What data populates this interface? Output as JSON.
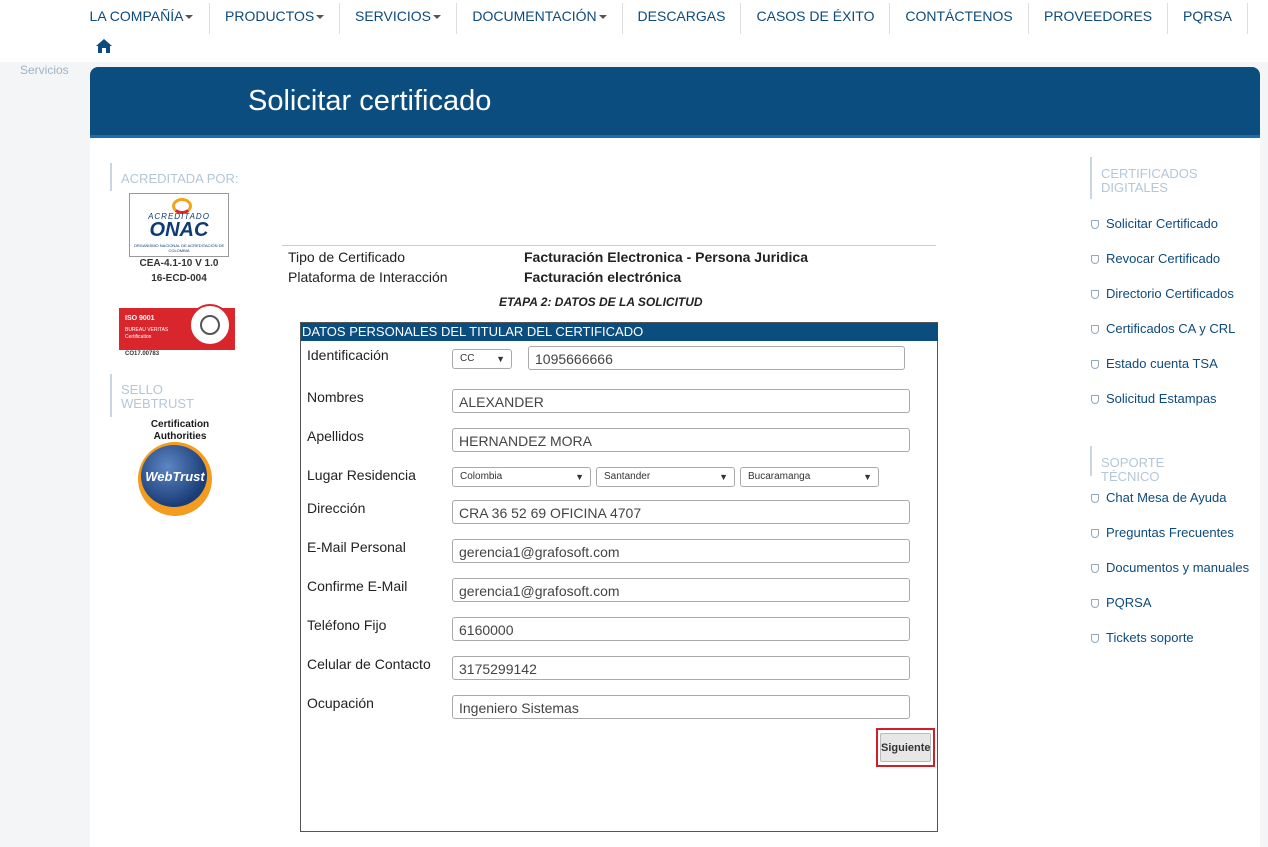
{
  "nav": {
    "items": [
      {
        "label": "LA COMPAÑÍA",
        "dropdown": true
      },
      {
        "label": "PRODUCTOS",
        "dropdown": true
      },
      {
        "label": "SERVICIOS",
        "dropdown": true
      },
      {
        "label": "DOCUMENTACIÓN",
        "dropdown": true
      },
      {
        "label": "DESCARGAS",
        "dropdown": false
      },
      {
        "label": "CASOS DE ÉXITO",
        "dropdown": false
      },
      {
        "label": "CONTÁCTENOS",
        "dropdown": false
      },
      {
        "label": "PROVEEDORES",
        "dropdown": false
      },
      {
        "label": "PQRSA",
        "dropdown": false
      }
    ],
    "home_icon": "home-icon"
  },
  "breadcrumb": "Servicios",
  "page_title": "Solicitar certificado",
  "left": {
    "accredited_title": "ACREDITADA POR:",
    "onac": {
      "acc": "ACREDITADO",
      "name": "ONAC",
      "small": "ORGANISMO NACIONAL DE ACREDITACIÓN DE COLOMBIA",
      "code1": "CEA-4.1-10 V 1.0",
      "code2": "16-ECD-004"
    },
    "bv": {
      "iso": "ISO 9001",
      "line1": "BUREAU VERITAS",
      "line2": "Certification",
      "code": "CO17.00783"
    },
    "webtrust_title": "SELLO WEBTRUST",
    "webtrust_caption": "Certification Authorities",
    "webtrust_name": "WebTrust"
  },
  "right": {
    "certs_title": "CERTIFICADOS DIGITALES",
    "certs_links": [
      "Solicitar Certificado",
      "Revocar Certificado",
      "Directorio Certificados",
      "Certificados CA y CRL",
      "Estado cuenta TSA",
      "Solicitud Estampas"
    ],
    "support_title": "SOPORTE TÉCNICO",
    "support_links": [
      "Chat Mesa de Ayuda",
      "Preguntas Frecuentes",
      "Documentos y manuales",
      "PQRSA",
      "Tickets soporte"
    ]
  },
  "info": {
    "tipo_label": "Tipo de Certificado",
    "tipo_value": "Facturación Electronica - Persona Juridica",
    "plataforma_label": "Plataforma de Interacción",
    "plataforma_value": "Facturación electrónica"
  },
  "etapa": "ETAPA 2: DATOS DE LA SOLICITUD",
  "form": {
    "header": "DATOS PERSONALES DEL TITULAR DEL CERTIFICADO",
    "id_label": "Identificación",
    "id_type": "CC",
    "id_number": "1095666666",
    "nombres_label": "Nombres",
    "nombres": "ALEXANDER",
    "apellidos_label": "Apellidos",
    "apellidos": "HERNANDEZ MORA",
    "lugar_label": "Lugar Residencia",
    "pais": "Colombia",
    "departamento": "Santander",
    "ciudad": "Bucaramanga",
    "direccion_label": "Dirección",
    "direccion": "CRA 36 52 69 OFICINA 4707",
    "email_label": "E-Mail Personal",
    "email": "gerencia1@grafosoft.com",
    "email_confirm_label": "Confirme E-Mail",
    "email_confirm": "gerencia1@grafosoft.com",
    "telefono_label": "Teléfono Fijo",
    "telefono": "6160000",
    "celular_label": "Celular de Contacto",
    "celular": "3175299142",
    "ocupacion_label": "Ocupación",
    "ocupacion": "Ingeniero Sistemas",
    "submit": "Siguiente"
  },
  "colors": {
    "brand_blue": "#0c4d7f",
    "link": "#0d4a7d",
    "highlight": "#d01f26"
  }
}
